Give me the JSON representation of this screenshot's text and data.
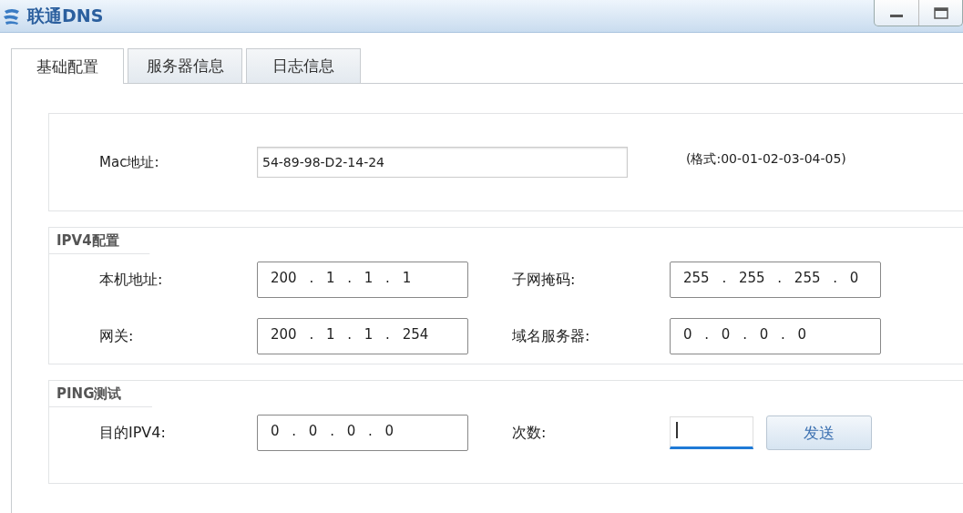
{
  "window": {
    "title": "联通DNS"
  },
  "tabs": [
    {
      "label": "基础配置",
      "selected": true
    },
    {
      "label": "服务器信息",
      "selected": false
    },
    {
      "label": "日志信息",
      "selected": false
    }
  ],
  "mac": {
    "label": "Mac地址:",
    "value": "54-89-98-D2-14-24",
    "hint": "(格式:00-01-02-03-04-05)"
  },
  "ipv4": {
    "title": "IPV4配置",
    "fields": [
      {
        "label": "本机地址:",
        "value": "200 . 1 . 1 . 1"
      },
      {
        "label": "子网掩码:",
        "value": "255 . 255 . 255 . 0"
      },
      {
        "label": "网关:",
        "value": "200 . 1 . 1 . 254"
      },
      {
        "label": "域名服务器:",
        "value": "0 . 0 . 0 . 0"
      }
    ]
  },
  "ping": {
    "title": "PING测试",
    "target": {
      "label": "目的IPV4:",
      "value": "0 . 0 . 0 . 0"
    },
    "count": {
      "label": "次数:",
      "focused": true
    },
    "send_button": "发送"
  }
}
